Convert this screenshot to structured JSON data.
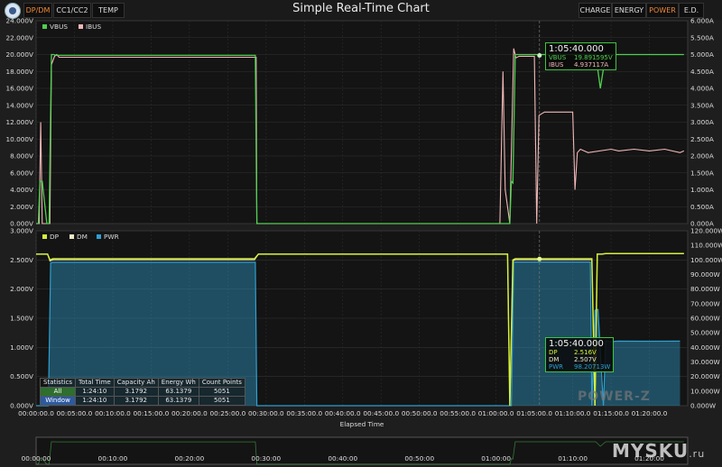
{
  "app": {
    "title": "Simple Real-Time Chart",
    "tabs_left": [
      "DP/DM",
      "CC1/CC2",
      "TEMP"
    ],
    "tabs_right": [
      "CHARGE",
      "ENERGY",
      "POWER",
      "E.D."
    ],
    "active_left": "DP/DM",
    "active_right": "POWER"
  },
  "colors": {
    "vbus": "#4fcf4f",
    "ibus": "#f2b8b8",
    "dp": "#d6f03a",
    "dm": "#ece6c8",
    "pwr": "#2f9fd0",
    "accent": "#f0883a"
  },
  "chart_data": [
    {
      "type": "line",
      "series": [
        {
          "name": "VBUS",
          "x": [
            0,
            0.3,
            0.5,
            0.8,
            1.4,
            1.7,
            2.0,
            2.3,
            2.6,
            28.6,
            28.8,
            28.9,
            61.8,
            62.0,
            62.2,
            62.5,
            62.8,
            63.2,
            73.0,
            73.6,
            74.3,
            74.5,
            75.5,
            76.0,
            84.2,
            84.5
          ],
          "values": [
            0,
            0,
            5.0,
            5.0,
            0,
            0,
            20.0,
            20.0,
            19.9,
            19.9,
            0.1,
            0,
            0,
            5.0,
            4.8,
            20.0,
            20.0,
            20.0,
            20.0,
            16.0,
            20.0,
            20.0,
            20.0,
            20.0,
            20.0,
            20.0
          ]
        },
        {
          "name": "IBUS",
          "x": [
            0,
            0.4,
            0.6,
            0.8,
            1.8,
            2.0,
            2.4,
            2.7,
            3.0,
            28.7,
            28.8,
            60.5,
            60.9,
            61.2,
            61.8,
            62.3,
            62.6,
            63.0,
            65.0,
            65.3,
            65.6,
            66.3,
            70.0,
            70.3,
            70.6,
            71.0,
            72.0,
            75.0,
            76.0,
            78.0,
            80.0,
            82.0,
            84.0,
            84.5
          ],
          "values": [
            0,
            0.0,
            3.0,
            0.0,
            0,
            4.7,
            4.95,
            5.0,
            4.92,
            4.92,
            0,
            0,
            4.5,
            1.0,
            0,
            5.18,
            4.9,
            4.95,
            4.95,
            0.0,
            3.2,
            3.3,
            3.3,
            1.0,
            2.1,
            2.2,
            2.1,
            2.2,
            2.15,
            2.2,
            2.15,
            2.2,
            2.1,
            2.15
          ]
        }
      ],
      "y_left": {
        "label_unit": "V",
        "ylim": [
          0,
          24
        ],
        "ticks": [
          "0.000V",
          "2.000V",
          "4.000V",
          "6.000V",
          "8.000V",
          "10.000V",
          "12.000V",
          "14.000V",
          "16.000V",
          "18.000V",
          "20.000V",
          "22.000V",
          "24.000V"
        ]
      },
      "y_right": {
        "label_unit": "A",
        "ylim": [
          0,
          6
        ],
        "ticks": [
          "0.000A",
          "0.500A",
          "1.000A",
          "1.500A",
          "2.000A",
          "2.500A",
          "3.000A",
          "3.500A",
          "4.000A",
          "4.500A",
          "5.000A",
          "5.500A",
          "6.000A"
        ]
      },
      "tooltip": {
        "time": "1:05:40.000",
        "rows": [
          {
            "name": "VBUS",
            "value": "19.891595V"
          },
          {
            "name": "IBUS",
            "value": "4.937117A"
          }
        ]
      },
      "grid": true,
      "legend": "top-left"
    },
    {
      "type": "area",
      "series": [
        {
          "name": "DP",
          "x": [
            0,
            1.5,
            1.8,
            2.2,
            28.5,
            29.0,
            61.5,
            61.8,
            62.2,
            62.5,
            72.5,
            72.9,
            73.2,
            73.8,
            74.3,
            84.5
          ],
          "values": [
            2.6,
            2.6,
            2.5,
            2.52,
            2.52,
            2.6,
            2.6,
            0.0,
            2.5,
            2.52,
            2.52,
            0.0,
            2.6,
            2.6,
            2.61,
            2.61
          ]
        },
        {
          "name": "DM",
          "x": [
            0,
            1.5,
            1.8,
            2.2,
            28.5,
            29.0,
            61.5,
            61.8,
            62.2,
            62.5,
            72.5,
            72.9,
            73.2,
            73.8,
            74.3,
            84.5
          ],
          "values": [
            2.6,
            2.6,
            2.48,
            2.5,
            2.5,
            2.6,
            2.6,
            0.0,
            2.48,
            2.5,
            2.5,
            0.0,
            2.6,
            2.6,
            2.61,
            2.61
          ]
        },
        {
          "name": "PWR",
          "x": [
            0,
            1.6,
            1.9,
            2.2,
            2.6,
            28.6,
            28.8,
            62.0,
            62.3,
            62.6,
            72.3,
            72.5,
            72.9,
            73.3,
            74.0,
            74.3,
            75.0,
            76.0,
            80.0,
            84.0
          ],
          "values": [
            0,
            0,
            98.0,
            98.5,
            98.4,
            98.4,
            0,
            0,
            98.5,
            98.6,
            98.6,
            0,
            65.5,
            66.0,
            0,
            44.5,
            44.0,
            44.3,
            44.2,
            44.3
          ]
        }
      ],
      "y_left": {
        "label_unit": "V",
        "ylim": [
          0,
          3
        ],
        "ticks": [
          "0.000V",
          "0.500V",
          "1.000V",
          "1.500V",
          "2.000V",
          "2.500V",
          "3.000V"
        ]
      },
      "y_right": {
        "label_unit": "W",
        "ylim": [
          0,
          120
        ],
        "ticks": [
          "0.000W",
          "10.000W",
          "20.000W",
          "30.000W",
          "40.000W",
          "50.000W",
          "60.000W",
          "70.000W",
          "80.000W",
          "90.000W",
          "100.000W",
          "110.000W",
          "120.000W"
        ]
      },
      "tooltip": {
        "time": "1:05:40.000",
        "rows": [
          {
            "name": "DP",
            "value": "2.516V"
          },
          {
            "name": "DM",
            "value": "2.507V"
          },
          {
            "name": "PWR",
            "value": "98.20713W"
          }
        ]
      },
      "x_ticks": [
        "00:00:00.0",
        "00:05:00.0",
        "00:10:00.0",
        "00:15:00.0",
        "00:20:00.0",
        "00:25:00.0",
        "00:30:00.0",
        "00:35:00.0",
        "00:40:00.0",
        "00:45:00.0",
        "00:50:00.0",
        "00:55:00.0",
        "01:00:00.0",
        "01:05:00.0",
        "01:10:00.0",
        "01:15:00.0",
        "01:20:00.0"
      ],
      "x_unit": "minutes",
      "xlim": [
        0,
        85
      ],
      "xlabel": "Elapsed Time",
      "grid": true,
      "legend": "top-left"
    }
  ],
  "overview": {
    "x_ticks": [
      "00:00:00",
      "00:10:00",
      "00:20:00",
      "00:30:00",
      "00:40:00",
      "00:50:00",
      "01:00:00",
      "01:10:00",
      "01:20:00"
    ]
  },
  "statistics": {
    "header": [
      "Statistics",
      "Total Time",
      "Capacity Ah",
      "Energy Wh",
      "Count Points"
    ],
    "rows": [
      [
        "All",
        "1:24:10",
        "3.1792",
        "63.1379",
        "5051"
      ],
      [
        "Window",
        "1:24:10",
        "3.1792",
        "63.1379",
        "5051"
      ]
    ]
  },
  "watermarks": {
    "brand": "POWER-Z",
    "site": "MYSKU",
    "site_suffix": ".ru"
  }
}
